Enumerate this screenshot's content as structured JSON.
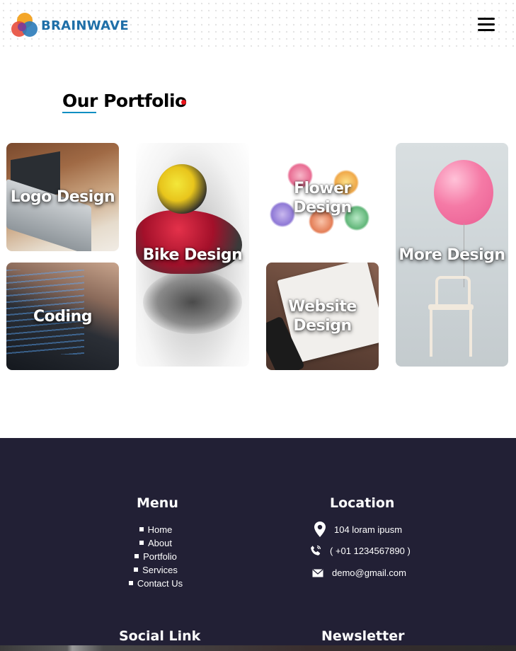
{
  "header": {
    "brand": "BRAINWAVE",
    "logo_colors": [
      "#f39c12",
      "#e74c3c",
      "#2b7bb9",
      "#7d3c98"
    ],
    "brand_color": "#1f6fa8",
    "menu_icon": "hamburger-menu-icon"
  },
  "portfolio": {
    "title": "Our Portfolio",
    "accent_dot_color": "#e8141b",
    "underline_color": "#0c8fc2",
    "items": [
      {
        "label": "Logo Design"
      },
      {
        "label": "Coding"
      },
      {
        "label": "Bike Design"
      },
      {
        "label": "Flower\nDesign"
      },
      {
        "label": "Website\nDesign"
      },
      {
        "label": "More Design"
      }
    ]
  },
  "footer": {
    "background": "#222035",
    "menu": {
      "heading": "Menu",
      "items": [
        "Home",
        "About",
        "Portfolio",
        "Services",
        "Contact Us"
      ]
    },
    "location": {
      "heading": "Location",
      "address": "104 loram ipusm",
      "phone": "( +01 1234567890 )",
      "email": "demo@gmail.com",
      "icons": [
        "map-pin-icon",
        "phone-icon",
        "mail-icon"
      ]
    },
    "social_heading": "Social Link",
    "newsletter_heading": "Newsletter"
  }
}
